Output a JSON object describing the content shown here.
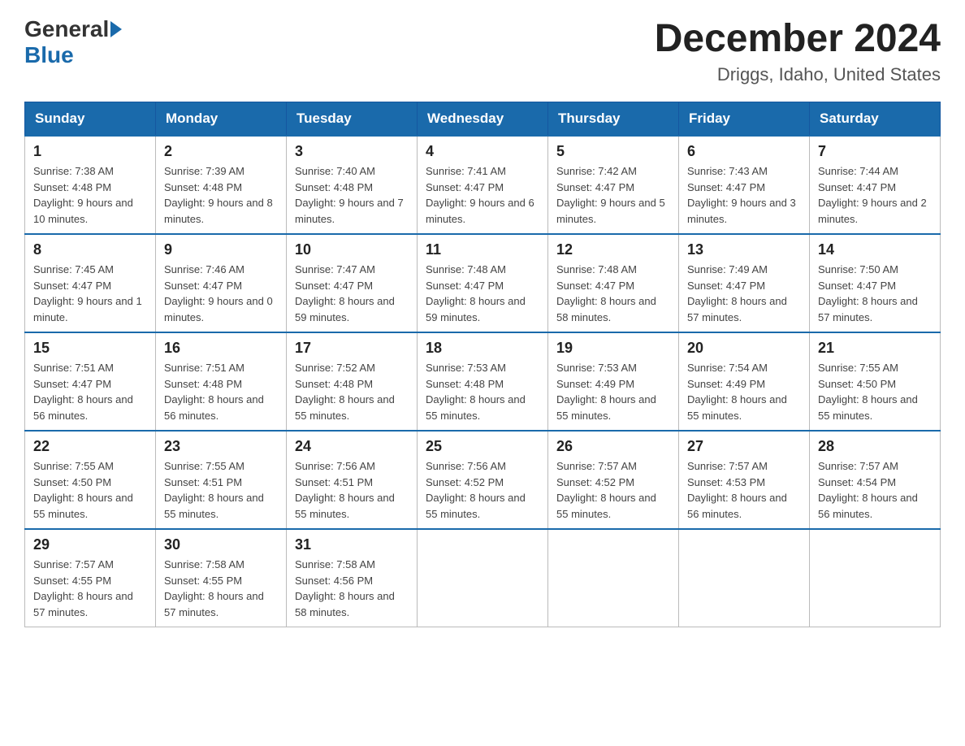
{
  "header": {
    "logo_general": "General",
    "logo_blue": "Blue",
    "month_title": "December 2024",
    "location": "Driggs, Idaho, United States"
  },
  "days_of_week": [
    "Sunday",
    "Monday",
    "Tuesday",
    "Wednesday",
    "Thursday",
    "Friday",
    "Saturday"
  ],
  "weeks": [
    [
      {
        "day": "1",
        "sunrise": "Sunrise: 7:38 AM",
        "sunset": "Sunset: 4:48 PM",
        "daylight": "Daylight: 9 hours and 10 minutes."
      },
      {
        "day": "2",
        "sunrise": "Sunrise: 7:39 AM",
        "sunset": "Sunset: 4:48 PM",
        "daylight": "Daylight: 9 hours and 8 minutes."
      },
      {
        "day": "3",
        "sunrise": "Sunrise: 7:40 AM",
        "sunset": "Sunset: 4:48 PM",
        "daylight": "Daylight: 9 hours and 7 minutes."
      },
      {
        "day": "4",
        "sunrise": "Sunrise: 7:41 AM",
        "sunset": "Sunset: 4:47 PM",
        "daylight": "Daylight: 9 hours and 6 minutes."
      },
      {
        "day": "5",
        "sunrise": "Sunrise: 7:42 AM",
        "sunset": "Sunset: 4:47 PM",
        "daylight": "Daylight: 9 hours and 5 minutes."
      },
      {
        "day": "6",
        "sunrise": "Sunrise: 7:43 AM",
        "sunset": "Sunset: 4:47 PM",
        "daylight": "Daylight: 9 hours and 3 minutes."
      },
      {
        "day": "7",
        "sunrise": "Sunrise: 7:44 AM",
        "sunset": "Sunset: 4:47 PM",
        "daylight": "Daylight: 9 hours and 2 minutes."
      }
    ],
    [
      {
        "day": "8",
        "sunrise": "Sunrise: 7:45 AM",
        "sunset": "Sunset: 4:47 PM",
        "daylight": "Daylight: 9 hours and 1 minute."
      },
      {
        "day": "9",
        "sunrise": "Sunrise: 7:46 AM",
        "sunset": "Sunset: 4:47 PM",
        "daylight": "Daylight: 9 hours and 0 minutes."
      },
      {
        "day": "10",
        "sunrise": "Sunrise: 7:47 AM",
        "sunset": "Sunset: 4:47 PM",
        "daylight": "Daylight: 8 hours and 59 minutes."
      },
      {
        "day": "11",
        "sunrise": "Sunrise: 7:48 AM",
        "sunset": "Sunset: 4:47 PM",
        "daylight": "Daylight: 8 hours and 59 minutes."
      },
      {
        "day": "12",
        "sunrise": "Sunrise: 7:48 AM",
        "sunset": "Sunset: 4:47 PM",
        "daylight": "Daylight: 8 hours and 58 minutes."
      },
      {
        "day": "13",
        "sunrise": "Sunrise: 7:49 AM",
        "sunset": "Sunset: 4:47 PM",
        "daylight": "Daylight: 8 hours and 57 minutes."
      },
      {
        "day": "14",
        "sunrise": "Sunrise: 7:50 AM",
        "sunset": "Sunset: 4:47 PM",
        "daylight": "Daylight: 8 hours and 57 minutes."
      }
    ],
    [
      {
        "day": "15",
        "sunrise": "Sunrise: 7:51 AM",
        "sunset": "Sunset: 4:47 PM",
        "daylight": "Daylight: 8 hours and 56 minutes."
      },
      {
        "day": "16",
        "sunrise": "Sunrise: 7:51 AM",
        "sunset": "Sunset: 4:48 PM",
        "daylight": "Daylight: 8 hours and 56 minutes."
      },
      {
        "day": "17",
        "sunrise": "Sunrise: 7:52 AM",
        "sunset": "Sunset: 4:48 PM",
        "daylight": "Daylight: 8 hours and 55 minutes."
      },
      {
        "day": "18",
        "sunrise": "Sunrise: 7:53 AM",
        "sunset": "Sunset: 4:48 PM",
        "daylight": "Daylight: 8 hours and 55 minutes."
      },
      {
        "day": "19",
        "sunrise": "Sunrise: 7:53 AM",
        "sunset": "Sunset: 4:49 PM",
        "daylight": "Daylight: 8 hours and 55 minutes."
      },
      {
        "day": "20",
        "sunrise": "Sunrise: 7:54 AM",
        "sunset": "Sunset: 4:49 PM",
        "daylight": "Daylight: 8 hours and 55 minutes."
      },
      {
        "day": "21",
        "sunrise": "Sunrise: 7:55 AM",
        "sunset": "Sunset: 4:50 PM",
        "daylight": "Daylight: 8 hours and 55 minutes."
      }
    ],
    [
      {
        "day": "22",
        "sunrise": "Sunrise: 7:55 AM",
        "sunset": "Sunset: 4:50 PM",
        "daylight": "Daylight: 8 hours and 55 minutes."
      },
      {
        "day": "23",
        "sunrise": "Sunrise: 7:55 AM",
        "sunset": "Sunset: 4:51 PM",
        "daylight": "Daylight: 8 hours and 55 minutes."
      },
      {
        "day": "24",
        "sunrise": "Sunrise: 7:56 AM",
        "sunset": "Sunset: 4:51 PM",
        "daylight": "Daylight: 8 hours and 55 minutes."
      },
      {
        "day": "25",
        "sunrise": "Sunrise: 7:56 AM",
        "sunset": "Sunset: 4:52 PM",
        "daylight": "Daylight: 8 hours and 55 minutes."
      },
      {
        "day": "26",
        "sunrise": "Sunrise: 7:57 AM",
        "sunset": "Sunset: 4:52 PM",
        "daylight": "Daylight: 8 hours and 55 minutes."
      },
      {
        "day": "27",
        "sunrise": "Sunrise: 7:57 AM",
        "sunset": "Sunset: 4:53 PM",
        "daylight": "Daylight: 8 hours and 56 minutes."
      },
      {
        "day": "28",
        "sunrise": "Sunrise: 7:57 AM",
        "sunset": "Sunset: 4:54 PM",
        "daylight": "Daylight: 8 hours and 56 minutes."
      }
    ],
    [
      {
        "day": "29",
        "sunrise": "Sunrise: 7:57 AM",
        "sunset": "Sunset: 4:55 PM",
        "daylight": "Daylight: 8 hours and 57 minutes."
      },
      {
        "day": "30",
        "sunrise": "Sunrise: 7:58 AM",
        "sunset": "Sunset: 4:55 PM",
        "daylight": "Daylight: 8 hours and 57 minutes."
      },
      {
        "day": "31",
        "sunrise": "Sunrise: 7:58 AM",
        "sunset": "Sunset: 4:56 PM",
        "daylight": "Daylight: 8 hours and 58 minutes."
      },
      null,
      null,
      null,
      null
    ]
  ]
}
